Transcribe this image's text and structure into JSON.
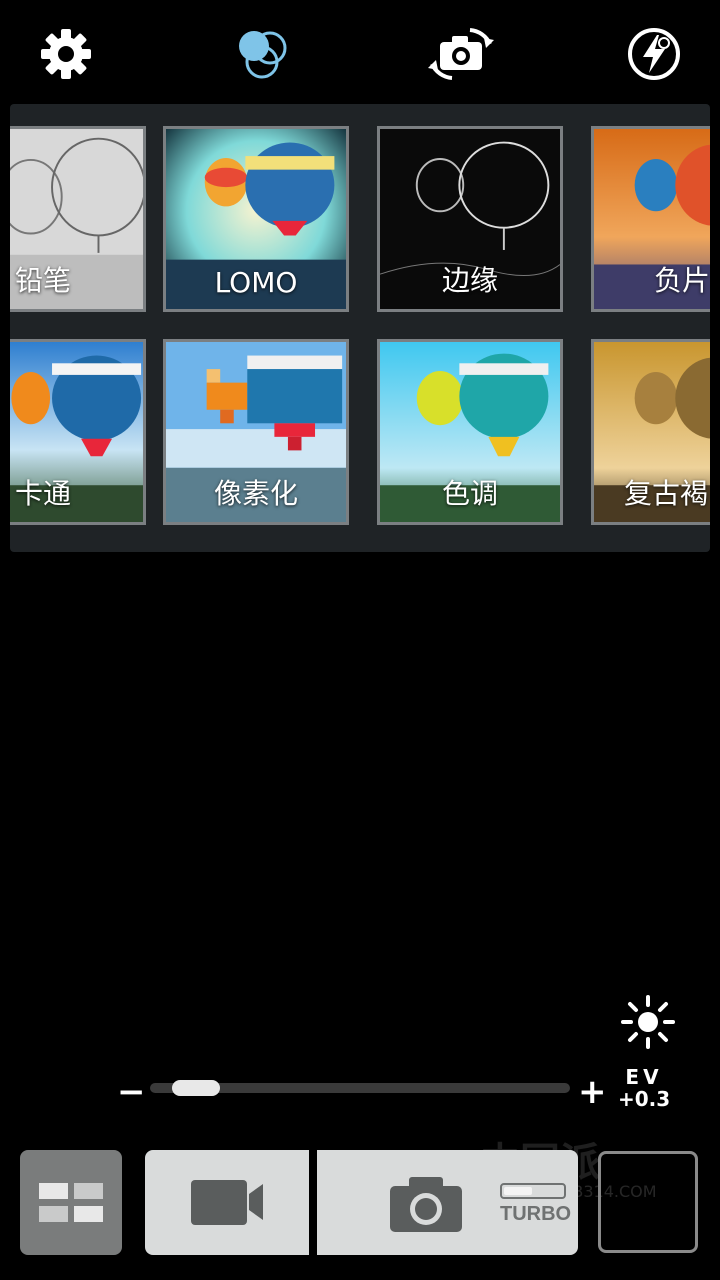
{
  "toolbar": {
    "settings_icon": "gear-icon",
    "filter_icon": "color-filter-icon",
    "switch_camera_icon": "camera-switch-icon",
    "flash_icon": "flash-auto-icon"
  },
  "filters": [
    {
      "label": "铅笔",
      "style": "pencil"
    },
    {
      "label": "LOMO",
      "style": "lomo"
    },
    {
      "label": "边缘",
      "style": "edge"
    },
    {
      "label": "负片",
      "style": "negative"
    },
    {
      "label": "卡通",
      "style": "cartoon"
    },
    {
      "label": "像素化",
      "style": "pixelate"
    },
    {
      "label": "色调",
      "style": "tone"
    },
    {
      "label": "复古褐",
      "style": "sepia"
    }
  ],
  "exposure": {
    "minus_label": "−",
    "plus_label": "+",
    "ev_title": "EV",
    "ev_value": "+0.3",
    "slider_fraction": 0.06,
    "brightness_icon": "sun-icon"
  },
  "bottom_bar": {
    "mode_icon": "grid-icon",
    "video_icon": "video-camera-icon",
    "shutter_icon": "camera-icon",
    "turbo_label": "TURBO"
  },
  "watermark": {
    "text": "中国派",
    "sub": "GB314.COM"
  },
  "colors": {
    "accent": "#7fc4e8",
    "panel": "#1f2326",
    "button": "#d9dbdb"
  }
}
